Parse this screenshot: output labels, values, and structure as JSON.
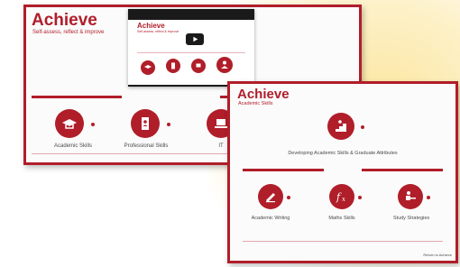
{
  "screen1": {
    "title": "Achieve",
    "subtitle": "Self-assess, reflect & improve",
    "video": {
      "title": "Achieve",
      "subtitle": "Self-assess, reflect & improve",
      "play_icon": "play-icon"
    },
    "tiles": [
      {
        "label": "Academic Skills",
        "icon": "mortarboard-icon"
      },
      {
        "label": "Professional Skills",
        "icon": "id-badge-icon"
      },
      {
        "label": "IT",
        "icon": "laptop-icon"
      }
    ]
  },
  "screen2": {
    "title": "Achieve",
    "subtitle": "Academic Skills",
    "hero": {
      "label": "Developing Academic Skills & Graduate Attributes",
      "icon": "person-climbing-steps-icon"
    },
    "tiles": [
      {
        "label": "Academic Writing",
        "icon": "pen-writing-icon"
      },
      {
        "label": "Maths Skills",
        "icon": "fx-function-icon"
      },
      {
        "label": "Study Strategies",
        "icon": "person-at-desk-icon"
      }
    ],
    "footer_link": "Return to Achieve"
  },
  "colors": {
    "accent": "#b01e2a",
    "background_glow": "#fbe6a0"
  }
}
